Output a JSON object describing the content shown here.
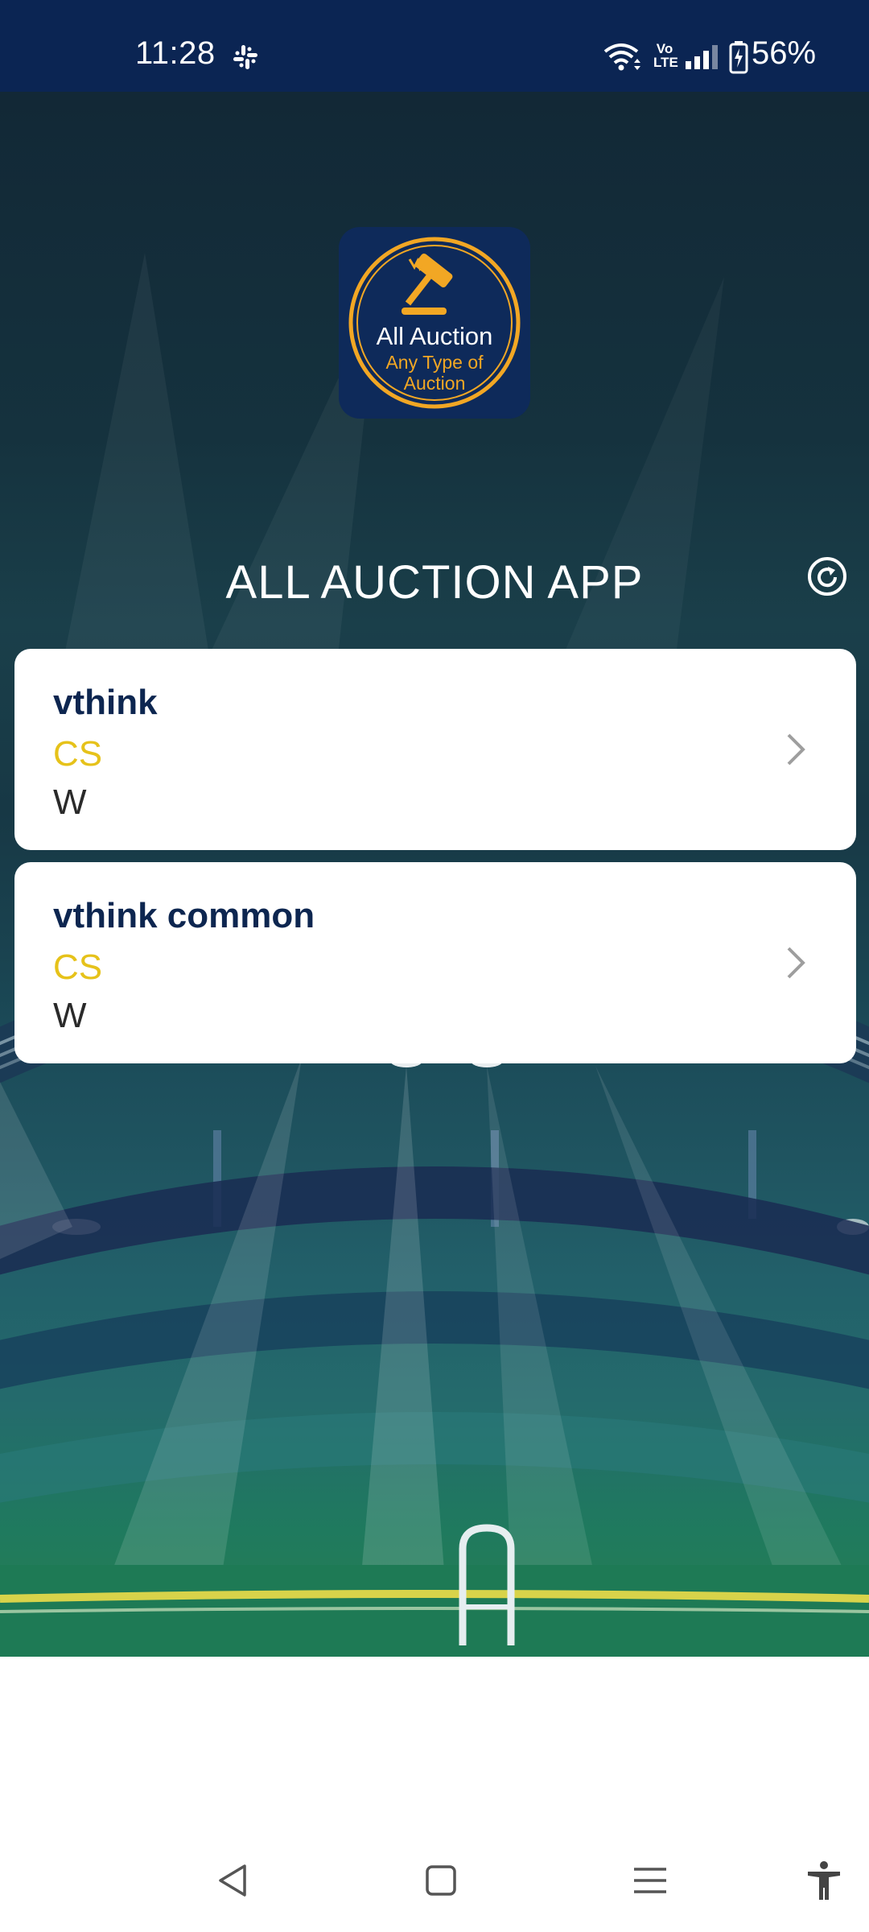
{
  "status_bar": {
    "time": "11:28",
    "volte_line1": "Vo",
    "volte_line2": "LTE",
    "battery_percent": "56%",
    "icons": [
      "slack-icon",
      "wifi-icon",
      "volte-icon",
      "signal-icon",
      "battery-icon"
    ]
  },
  "logo": {
    "title": "All Auction",
    "subtitle_line1": "Any Type of",
    "subtitle_line2": "Auction",
    "icon": "gavel-icon"
  },
  "header": {
    "title": "ALL AUCTION APP",
    "refresh_icon": "refresh-icon"
  },
  "auctions": [
    {
      "name": "vthink",
      "code": "CS",
      "w": "W"
    },
    {
      "name": "vthink common",
      "code": "CS",
      "w": "W"
    }
  ],
  "nav": {
    "icons": [
      "back-icon",
      "home-icon",
      "recents-icon",
      "accessibility-icon"
    ]
  },
  "colors": {
    "status_bar_bg": "#0b2553",
    "title_navy": "#0d2650",
    "code_yellow": "#e6c21a",
    "logo_gold": "#f2a724"
  }
}
